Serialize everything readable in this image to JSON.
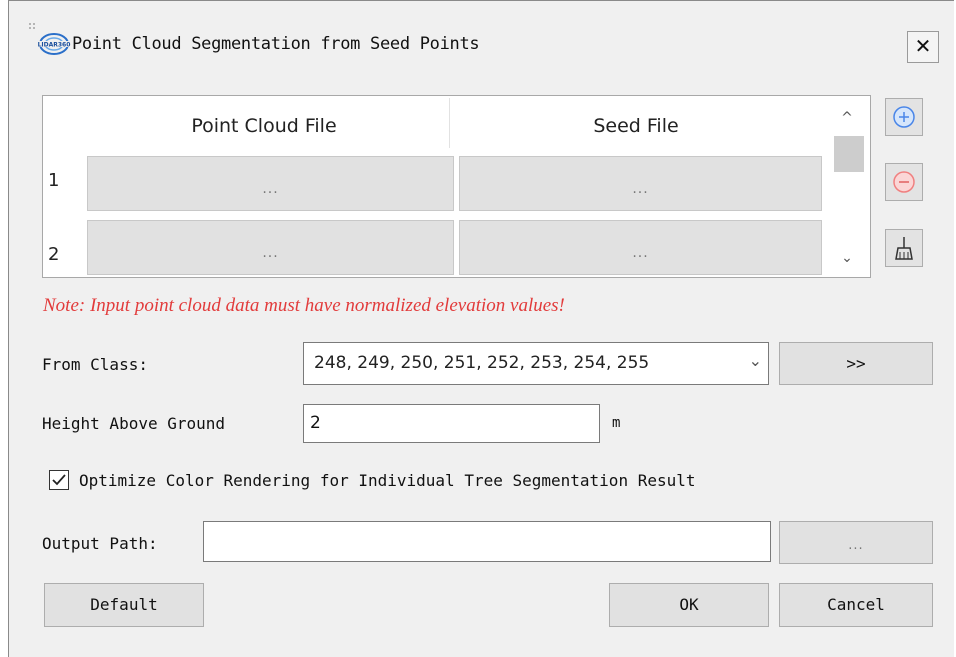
{
  "window": {
    "title": "Point Cloud Segmentation from Seed Points",
    "close_glyph": "✕",
    "logo_icon": "lidar360-logo-icon"
  },
  "table": {
    "headers": [
      "Point Cloud File",
      "Seed File"
    ],
    "rows": [
      {
        "num": "1",
        "point_cloud_btn": "...",
        "seed_btn": "..."
      },
      {
        "num": "2",
        "point_cloud_btn": "...",
        "seed_btn": "..."
      }
    ],
    "scroll_up": "^",
    "scroll_down": "⌄"
  },
  "side_buttons": {
    "add_icon": "plus-circle-icon",
    "remove_icon": "minus-circle-icon",
    "clear_icon": "broom-icon"
  },
  "note": "Note: Input point cloud data must have normalized elevation values!",
  "from_class": {
    "label": "From Class:",
    "value": "248, 249, 250, 251, 252, 253, 254, 255",
    "select_button": ">>"
  },
  "height": {
    "label": "Height Above Ground",
    "value": "2",
    "unit": "m"
  },
  "optimize": {
    "label": "Optimize Color Rendering for Individual Tree Segmentation Result",
    "checked": true
  },
  "output": {
    "label": "Output Path:",
    "value": "",
    "browse_button": "..."
  },
  "footer": {
    "default_button": "Default",
    "ok_button": "OK",
    "cancel_button": "Cancel"
  },
  "colors": {
    "note": "#e23b3b",
    "add_icon": "#4a86e8",
    "remove_icon": "#f08080"
  }
}
